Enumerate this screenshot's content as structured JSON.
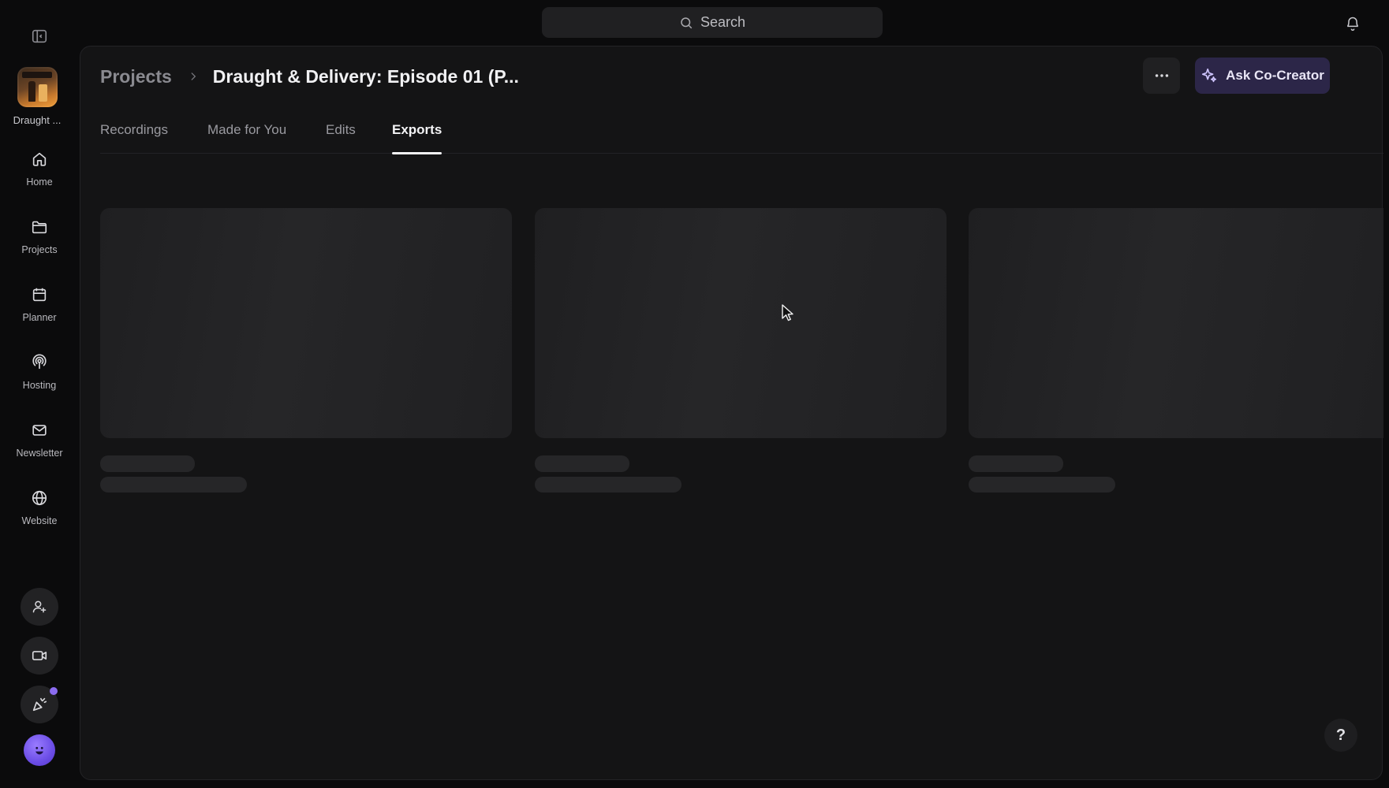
{
  "search": {
    "placeholder": "Search"
  },
  "sidebar": {
    "project_label": "Draught ...",
    "items": [
      {
        "label": "Home",
        "icon": "home-icon"
      },
      {
        "label": "Projects",
        "icon": "folder-icon"
      },
      {
        "label": "Planner",
        "icon": "calendar-icon"
      },
      {
        "label": "Hosting",
        "icon": "podcast-icon"
      },
      {
        "label": "Newsletter",
        "icon": "mail-icon"
      },
      {
        "label": "Website",
        "icon": "globe-icon"
      }
    ],
    "bottom_icons": [
      "add-user-icon",
      "video-camera-icon",
      "party-popper-icon",
      "avatar"
    ]
  },
  "header": {
    "breadcrumb_root": "Projects",
    "title": "Draught & Delivery: Episode 01 (P...",
    "cocreator_label": "Ask Co-Creator"
  },
  "tabs": [
    {
      "label": "Recordings",
      "active": false
    },
    {
      "label": "Made for You",
      "active": false
    },
    {
      "label": "Edits",
      "active": false
    },
    {
      "label": "Exports",
      "active": true
    }
  ],
  "help": {
    "label": "?"
  },
  "colors": {
    "background": "#0b0b0c",
    "panel": "#141415",
    "accent_button": "#2c2648",
    "accent": "#8b6cf0"
  }
}
